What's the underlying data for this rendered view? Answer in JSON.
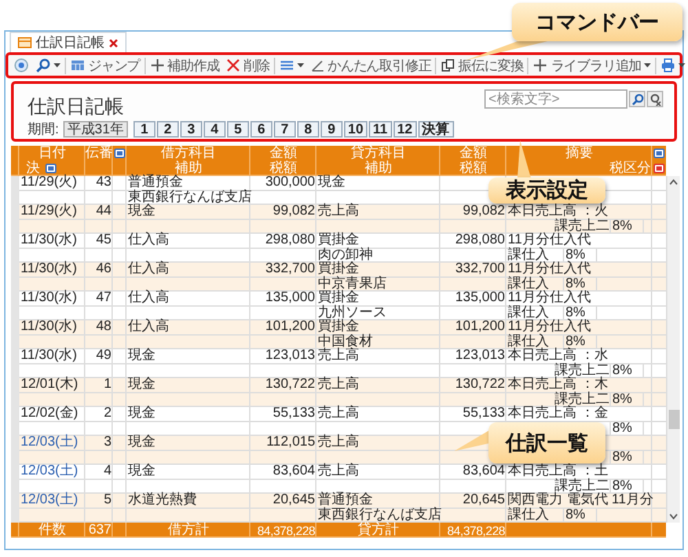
{
  "tab": {
    "title": "仕訳日記帳",
    "closable": true
  },
  "toolbar": {
    "left": [
      {
        "kind": "circle",
        "caret": false
      },
      {
        "kind": "search",
        "caret": true
      },
      {
        "kind": "grid",
        "label": "ジャンプ",
        "caret": false
      },
      {
        "kind": "plus",
        "label": "補助作成",
        "caret": false
      },
      {
        "kind": "delete",
        "label": "削除",
        "caret": false
      },
      {
        "kind": "lines",
        "caret": true
      }
    ],
    "right": [
      {
        "kind": "pencil",
        "label": "かんたん取引修正",
        "caret": false
      },
      {
        "kind": "copy",
        "label": "振伝に変換",
        "caret": false
      },
      {
        "kind": "plus",
        "label": "ライブラリ追加",
        "caret": true
      },
      {
        "kind": "printer",
        "caret": true
      }
    ]
  },
  "settings": {
    "title": "仕訳日記帳",
    "search": {
      "placeholder": "<検索文字>"
    },
    "period_label": "期間:",
    "era": "平成31年",
    "months": [
      "1",
      "2",
      "3",
      "4",
      "5",
      "6",
      "7",
      "8",
      "9",
      "10",
      "11",
      "12",
      "決算"
    ]
  },
  "table": {
    "header_top": {
      "date": "日付",
      "number": "伝番",
      "debit": "借方科目",
      "debit_amount": "金額",
      "credit": "貸方科目",
      "credit_amount": "金額",
      "memo": "摘要"
    },
    "header_bottom": {
      "settled": "決",
      "debit_sub": "補助",
      "debit_tax": "税額",
      "credit_sub": "補助",
      "credit_tax": "税額",
      "tax_class": "税区分"
    },
    "entries": [
      {
        "date": "11/29(火)",
        "weekend": false,
        "number": "43",
        "debit": "普通預金",
        "debit_sub": "東西銀行なんば支店",
        "debit_amount": "300,000",
        "credit": "現金"
      },
      {
        "date": "11/29(火)",
        "weekend": false,
        "number": "44",
        "debit": "現金",
        "debit_amount": "99,082",
        "credit": "売上高",
        "credit_amount": "99,082",
        "memo": "本日売上高 ：火",
        "tax": {
          "kind": "sales",
          "class": "課売上二",
          "rate": "8%"
        }
      },
      {
        "date": "11/30(水)",
        "weekend": false,
        "number": "45",
        "debit": "仕入高",
        "debit_amount": "298,080",
        "credit": "買掛金",
        "credit_sub": "肉の卸神",
        "credit_amount": "298,080",
        "memo": "11月分仕入代",
        "tax": {
          "kind": "purchase",
          "class": "課仕入",
          "rate": "8%"
        }
      },
      {
        "date": "11/30(水)",
        "weekend": false,
        "number": "46",
        "debit": "仕入高",
        "debit_amount": "332,700",
        "credit": "買掛金",
        "credit_sub": "中京青果店",
        "credit_amount": "332,700",
        "memo": "11月分仕入代",
        "tax": {
          "kind": "purchase",
          "class": "課仕入",
          "rate": "8%"
        }
      },
      {
        "date": "11/30(水)",
        "weekend": false,
        "number": "47",
        "debit": "仕入高",
        "debit_amount": "135,000",
        "credit": "買掛金",
        "credit_sub": "九州ソース",
        "credit_amount": "135,000",
        "memo": "11月分仕入代",
        "tax": {
          "kind": "purchase",
          "class": "課仕入",
          "rate": "8%"
        }
      },
      {
        "date": "11/30(水)",
        "weekend": false,
        "number": "48",
        "debit": "仕入高",
        "debit_amount": "101,200",
        "credit": "買掛金",
        "credit_sub": "中国食材",
        "credit_amount": "101,200",
        "memo": "11月分仕入代",
        "tax": {
          "kind": "purchase",
          "class": "課仕入",
          "rate": "8%"
        }
      },
      {
        "date": "11/30(水)",
        "weekend": false,
        "number": "49",
        "debit": "現金",
        "debit_amount": "123,013",
        "credit": "売上高",
        "credit_amount": "123,013",
        "memo": "本日売上高 ：水",
        "tax": {
          "kind": "sales",
          "class": "課売上二",
          "rate": "8%"
        }
      },
      {
        "date": "12/01(木)",
        "weekend": false,
        "number": "1",
        "debit": "現金",
        "debit_amount": "130,722",
        "credit": "売上高",
        "credit_amount": "130,722",
        "memo": "本日売上高 ：木",
        "tax": {
          "kind": "sales",
          "class": "課売上二",
          "rate": "8%"
        }
      },
      {
        "date": "12/02(金)",
        "weekend": false,
        "number": "2",
        "debit": "現金",
        "debit_amount": "55,133",
        "credit": "売上高",
        "credit_amount": "55,133",
        "memo": "本日売上高 ：金",
        "tax": {
          "kind": "sales",
          "rate": "8%"
        }
      },
      {
        "date": "12/03(土)",
        "weekend": true,
        "number": "3",
        "debit": "現金",
        "debit_amount": "112,015",
        "credit": "売上高",
        "tax": {
          "kind": "sales",
          "rate": "8%"
        }
      },
      {
        "date": "12/03(土)",
        "weekend": true,
        "number": "4",
        "debit": "現金",
        "debit_amount": "83,604",
        "credit": "売上高",
        "credit_amount": "83,604",
        "memo": "本日売上高 ：土",
        "tax": {
          "kind": "sales",
          "class": "課売上二",
          "rate": "8%"
        }
      },
      {
        "date": "12/03(土)",
        "weekend": true,
        "number": "5",
        "debit": "水道光熱費",
        "debit_amount": "20,645",
        "credit": "普通預金",
        "credit_sub": "東西銀行なんば支店",
        "credit_amount": "20,645",
        "memo": "関西電力 電気代 11月分",
        "tax": {
          "kind": "purchase",
          "class": "課仕入",
          "rate": "8%"
        }
      }
    ],
    "footer": {
      "count_label": "件数",
      "count": "637",
      "debit_total_label": "借方計",
      "debit_total": "84,378,228",
      "credit_total_label": "貸方計",
      "credit_total": "84,378,228"
    }
  },
  "callouts": [
    {
      "text": "コマンドバー"
    },
    {
      "text": "表示設定"
    },
    {
      "text": "仕訳一覧"
    }
  ]
}
